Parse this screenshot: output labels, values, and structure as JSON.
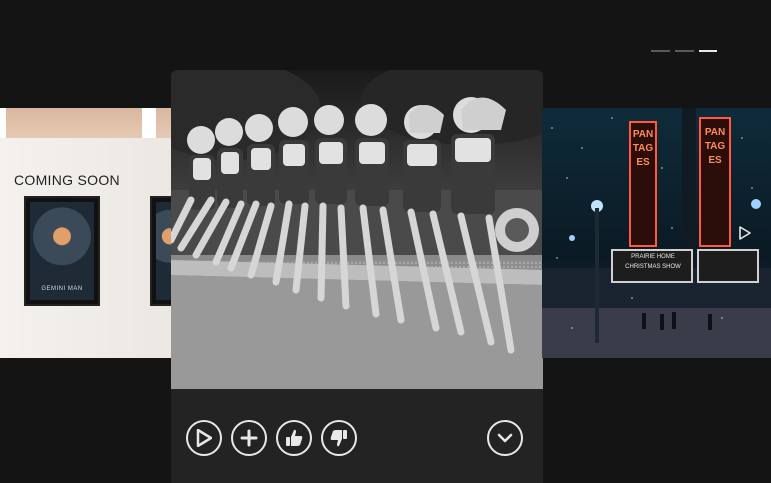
{
  "pager": {
    "count": 3,
    "active_index": 2
  },
  "left_card": {
    "sign_text": "COMING SOON",
    "poster_title": "GEMINI MAN"
  },
  "center_card": {
    "buttons": [
      {
        "name": "play-button",
        "icon": "play-icon"
      },
      {
        "name": "add-to-list-button",
        "icon": "plus-icon"
      },
      {
        "name": "like-button",
        "icon": "thumbs-up-icon"
      },
      {
        "name": "dislike-button",
        "icon": "thumbs-down-icon"
      }
    ],
    "more_info_icon": "chevron-down-icon"
  },
  "right_card": {
    "marquee_left": "PANTAGES",
    "marquee_right": "PANTAGES",
    "marquee_board_line1": "PRAIRIE HOME",
    "marquee_board_line2": "CHRISTMAS SHOW"
  },
  "colors": {
    "background": "#141414",
    "card_footer": "#232323",
    "icon_stroke": "#e8e8e8",
    "pager_inactive": "#5a5a5a",
    "pager_active": "#e8e8e8",
    "neon": "#ff5a3c"
  }
}
